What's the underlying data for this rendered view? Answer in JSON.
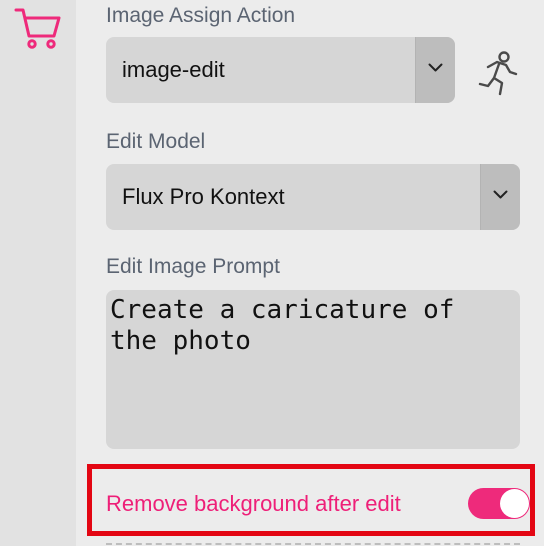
{
  "sidebar": {
    "cart_icon": "shopping-cart-icon",
    "accent_color": "#ee2a7b"
  },
  "image_assign_action": {
    "label": "Image Assign Action",
    "selected": "image-edit",
    "run_icon": "running-person-icon"
  },
  "edit_model": {
    "label": "Edit Model",
    "selected": "Flux Pro Kontext"
  },
  "edit_prompt": {
    "label": "Edit Image Prompt",
    "value": "Create a caricature of the photo"
  },
  "remove_background": {
    "label": "Remove background after edit",
    "enabled": true,
    "highlight_color": "#e30613"
  }
}
